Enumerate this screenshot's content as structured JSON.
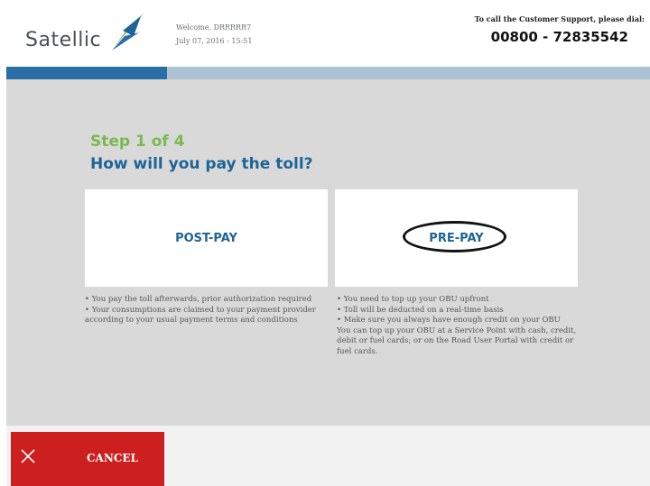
{
  "header": {
    "brand": "Satellic",
    "welcome": "Welcome, DRRRRR7",
    "datetime": "July 07, 2016 - 15:51",
    "support_label": "To call the Customer Support, please dial:",
    "support_phone": "00800 - 72835542"
  },
  "progress": {
    "current_step": 1,
    "total_steps": 4,
    "fraction": 0.25
  },
  "main": {
    "step": "Step 1 of 4",
    "question": "How will you pay the toll?",
    "options": [
      {
        "label": "POST-PAY",
        "description": [
          "• You pay the toll afterwards, prior authorization required",
          "• Your consumptions are claimed to your payment provider according to your usual payment terms and conditions"
        ]
      },
      {
        "label": "PRE-PAY",
        "highlighted": true,
        "description": [
          "• You need to top up your OBU upfront",
          "• Toll will be deducted on a real-time basis",
          "• Make sure you always have enough credit on your OBU",
          "You can top up your OBU at a Service Point with cash, credit, debit or fuel cards; or on the Road User Portal with credit or fuel cards."
        ]
      }
    ]
  },
  "footer": {
    "cancel_label": "CANCEL"
  },
  "colors": {
    "brand_blue": "#1d6497",
    "step_green": "#7ab850",
    "cancel_red": "#cc1f1f",
    "progress_fill": "#2a6ea6",
    "progress_track": "#abc3d4"
  },
  "icons": {
    "logo": "satellic-logo-mark",
    "cancel": "close-icon"
  }
}
